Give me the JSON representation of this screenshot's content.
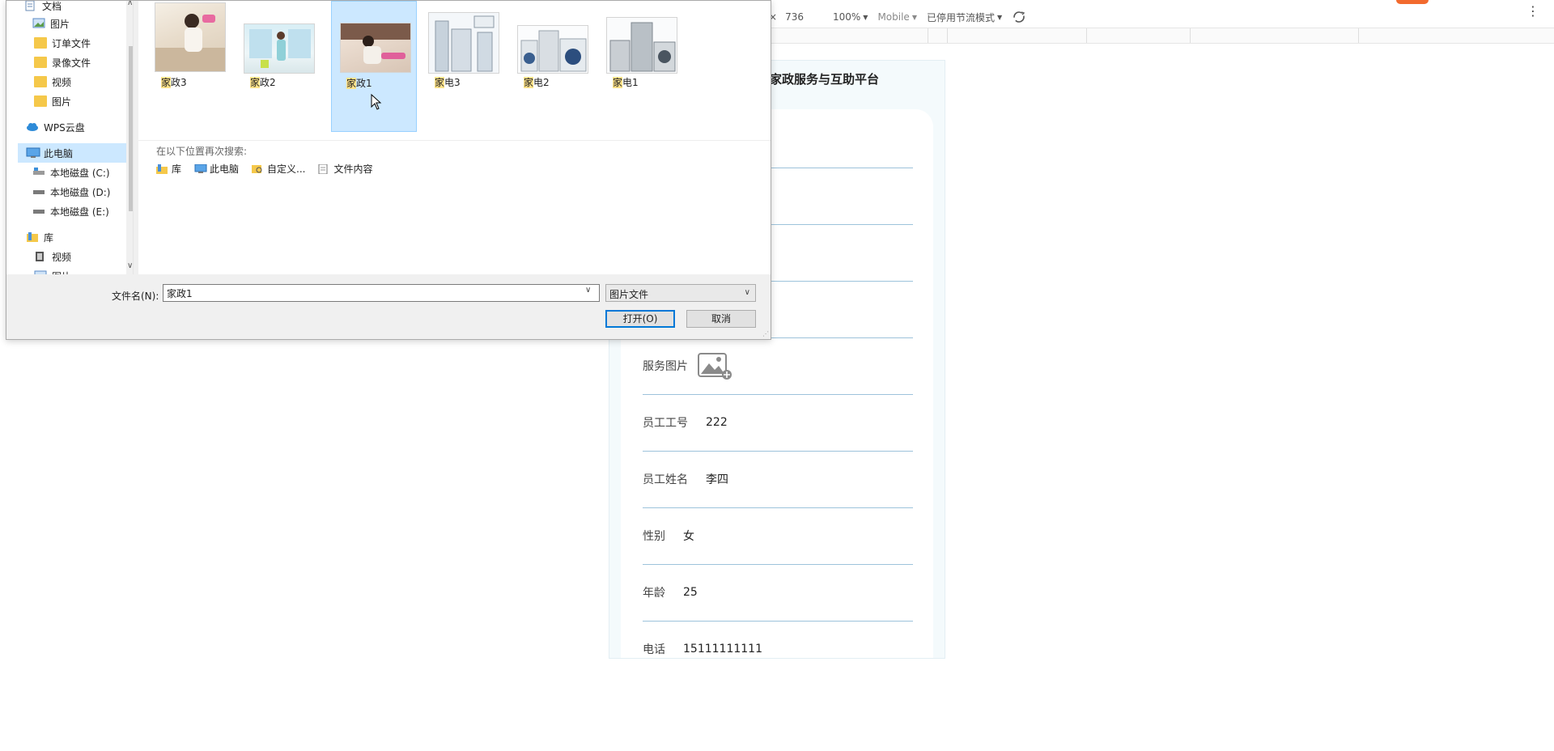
{
  "devtools": {
    "close_glyph": "×",
    "height": "736",
    "zoom": "100%",
    "device_type": "Mobile",
    "throttle": "已停用节流模式",
    "rotate_icon": "rotate-icon",
    "menu_icon": "kebab-icon"
  },
  "mobile": {
    "header_title": "家政服务与互助平台",
    "rows": [
      {
        "label": "服务图片",
        "value": ""
      },
      {
        "label": "员工工号",
        "value": "222"
      },
      {
        "label": "员工姓名",
        "value": "李四"
      },
      {
        "label": "性别",
        "value": "女"
      },
      {
        "label": "年龄",
        "value": "25"
      },
      {
        "label": "电话",
        "value": "15111111111"
      }
    ]
  },
  "dialog": {
    "nav_items": [
      {
        "label": "文档",
        "icon": "document-icon",
        "pinned": true
      },
      {
        "label": "图片",
        "icon": "picture-icon",
        "pinned": true
      },
      {
        "label": "订单文件",
        "icon": "folder-icon"
      },
      {
        "label": "录像文件",
        "icon": "folder-icon"
      },
      {
        "label": "视频",
        "icon": "folder-icon"
      },
      {
        "label": "图片",
        "icon": "folder-icon"
      },
      {
        "label": "WPS云盘",
        "icon": "cloud-icon"
      },
      {
        "label": "此电脑",
        "icon": "computer-icon",
        "selected": true
      },
      {
        "label": "本地磁盘 (C:)",
        "icon": "drive-icon"
      },
      {
        "label": "本地磁盘 (D:)",
        "icon": "drive-icon"
      },
      {
        "label": "本地磁盘 (E:)",
        "icon": "drive-icon"
      },
      {
        "label": "库",
        "icon": "library-icon"
      },
      {
        "label": "视频",
        "icon": "video-icon"
      },
      {
        "label": "图片",
        "icon": "picture-icon"
      }
    ],
    "files": [
      {
        "name": "家政3",
        "highlight": "家",
        "rest": "政3"
      },
      {
        "name": "家政2",
        "highlight": "家",
        "rest": "政2"
      },
      {
        "name": "家政1",
        "highlight": "家",
        "rest": "政1",
        "selected": true
      },
      {
        "name": "家电3",
        "highlight": "家",
        "rest": "电3"
      },
      {
        "name": "家电2",
        "highlight": "家",
        "rest": "电2"
      },
      {
        "name": "家电1",
        "highlight": "家",
        "rest": "电1"
      }
    ],
    "search_again_title": "在以下位置再次搜索:",
    "search_locations": [
      "库",
      "此电脑",
      "自定义...",
      "文件内容"
    ],
    "filename_label": "文件名(N):",
    "filename_value": "家政1",
    "file_type": "图片文件",
    "open_button": "打开(O)",
    "cancel_button": "取消"
  },
  "colors": {
    "accent": "#0078d7",
    "selection": "#cce8ff",
    "underline": "#9dc3db",
    "mobile_bg": "#f4fafc"
  }
}
